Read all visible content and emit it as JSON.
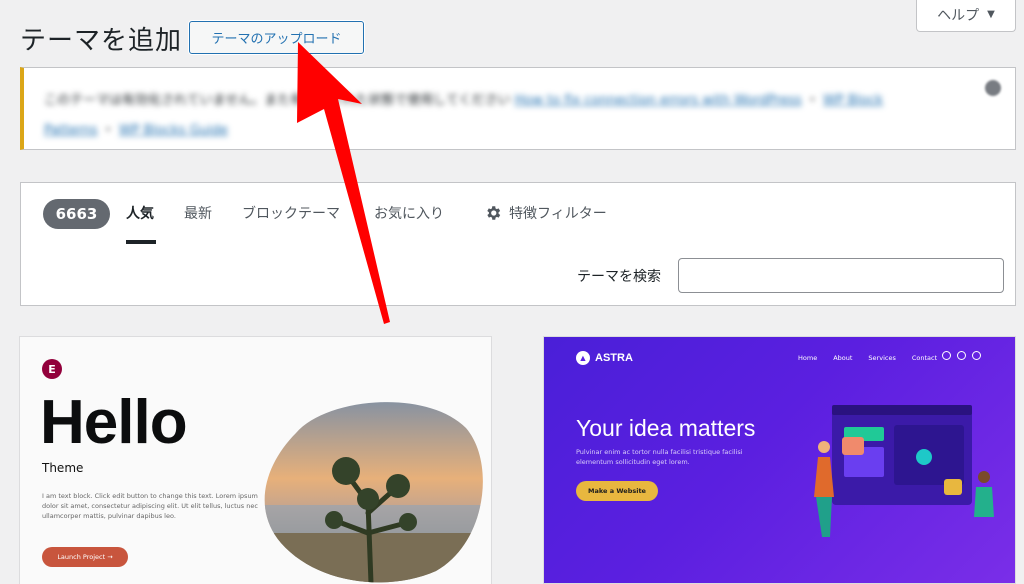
{
  "header": {
    "title": "テーマを追加",
    "upload_button": "テーマのアップロード",
    "help_tab": "ヘルプ"
  },
  "notice": {
    "text_prefix": "このテーマは有効化されていません。また有効化された状態で使用してください",
    "link1": "How to fix connection errors with WordPress",
    "link2": "WP Block Patterns",
    "link3": "WP Blocks Guide"
  },
  "filters": {
    "count": "6663",
    "tabs": [
      "人気",
      "最新",
      "ブロックテーマ",
      "お気に入り"
    ],
    "feature_filter": "特徴フィルター",
    "search_label": "テーマを検索",
    "search_value": ""
  },
  "themes": {
    "hello": {
      "logo": "E",
      "title": "Hello",
      "subtitle": "Theme",
      "body": "I am text block. Click edit button to change this text. Lorem ipsum dolor sit amet, consectetur adipiscing elit. Ut elit tellus, luctus nec ullamcorper mattis, pulvinar dapibus leo.",
      "button": "Launch Project →"
    },
    "astra": {
      "brand": "ASTRA",
      "nav": [
        "Home",
        "About",
        "Services",
        "Contact"
      ],
      "headline": "Your idea matters",
      "text": "Pulvinar enim ac tortor nulla facilisi tristique facilisi elementum sollicitudin eget lorem.",
      "button": "Make a Website"
    }
  },
  "colors": {
    "accent": "#2271b1",
    "arrow": "#ff0000",
    "notice_border": "#dba617",
    "astra_bg": "#5b1fe0"
  }
}
